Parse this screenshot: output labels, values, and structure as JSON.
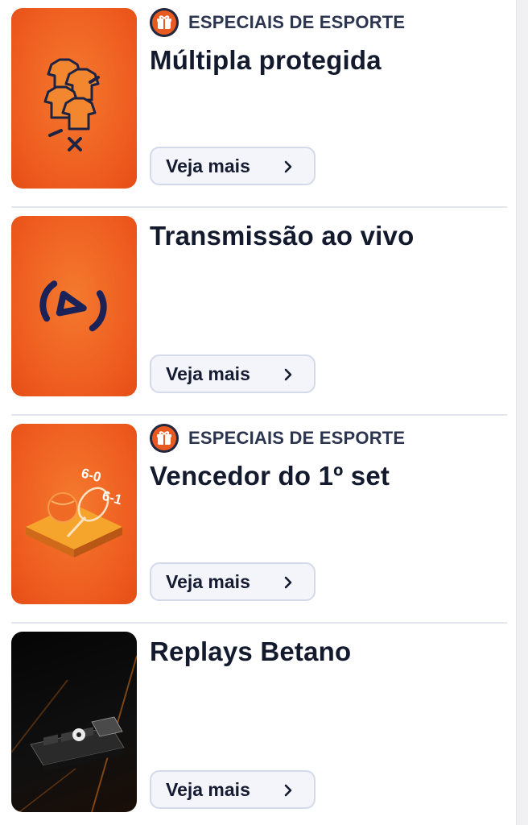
{
  "items": [
    {
      "tag": "ESPECIAIS DE ESPORTE",
      "title": "Múltipla protegida",
      "button": "Veja mais",
      "image_icon": "jerseys-cross-icon",
      "tag_icon": "gift-icon"
    },
    {
      "tag": "",
      "title": "Transmissão ao vivo",
      "button": "Veja mais",
      "image_icon": "live-stream-icon"
    },
    {
      "tag": "ESPECIAIS DE ESPORTE",
      "title": "Vencedor do 1º set",
      "button": "Veja mais",
      "image_icon": "tennis-score-icon",
      "image_text_1": "6-0",
      "image_text_2": "6-1",
      "tag_icon": "gift-icon"
    },
    {
      "tag": "",
      "title": "Replays Betano",
      "button": "Veja mais",
      "image_icon": "replay-device-icon"
    }
  ],
  "colors": {
    "accent": "#ee5b1e",
    "text": "#141a2e",
    "tag_text": "#2c3550",
    "button_bg": "#f3f5fb",
    "button_border": "#d5daea"
  }
}
